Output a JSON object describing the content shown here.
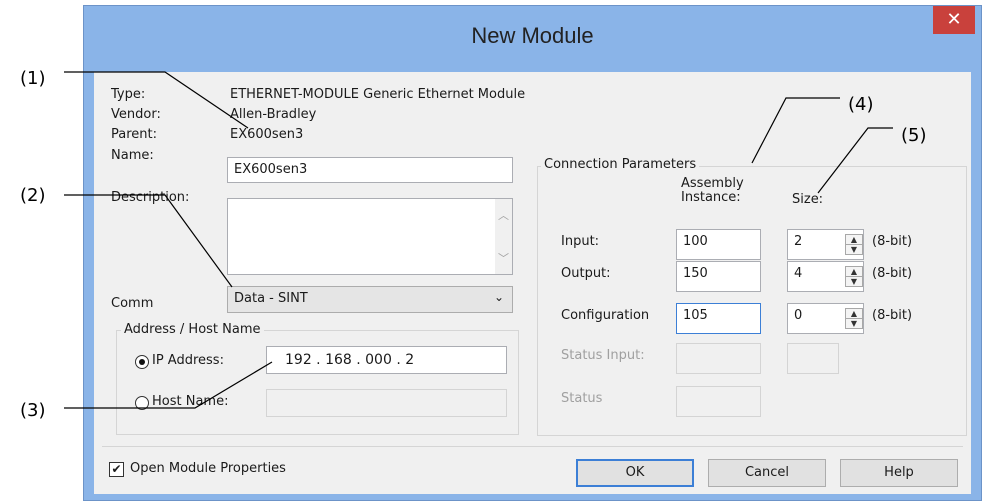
{
  "window": {
    "title": "New Module",
    "close_glyph": "✕"
  },
  "callouts": [
    "(1)",
    "(2)",
    "(3)",
    "(4)",
    "(5)"
  ],
  "info": {
    "type_label": "Type:",
    "type_value": "ETHERNET-MODULE Generic Ethernet Module",
    "vendor_label": "Vendor:",
    "vendor_value": "Allen-Bradley",
    "parent_label": "Parent:",
    "parent_value": "EX600sen3"
  },
  "name": {
    "label": "Name:",
    "value": "EX600sen3"
  },
  "description": {
    "label": "Description:",
    "value": ""
  },
  "comm": {
    "label": "Comm",
    "selected": "Data - SINT"
  },
  "address_group": {
    "title": "Address / Host Name",
    "ip_label": "IP Address:",
    "ip_value": "192 . 168 . 000 . 2",
    "ip_selected": true,
    "host_label": "Host Name:",
    "host_value": ""
  },
  "connection": {
    "title": "Connection Parameters",
    "col_assembly": "Assembly Instance:",
    "col_size": "Size:",
    "unit": "(8-bit)",
    "rows": [
      {
        "label": "Input:",
        "instance": "100",
        "size": "2",
        "enabled": true
      },
      {
        "label": "Output:",
        "instance": "150",
        "size": "4",
        "enabled": true
      },
      {
        "label": "Configuration",
        "instance": "105",
        "size": "0",
        "enabled": true
      },
      {
        "label": "Status Input:",
        "instance": "",
        "size": "",
        "enabled": false
      },
      {
        "label": "Status",
        "instance": "",
        "size": "",
        "enabled": false
      }
    ]
  },
  "footer": {
    "open_props_label": "Open Module Properties",
    "open_props_checked": true,
    "ok": "OK",
    "cancel": "Cancel",
    "help": "Help"
  },
  "colors": {
    "frame": "#8ab4e8",
    "close_button": "#c9413c",
    "client": "#f0f0f0",
    "focus": "#3c7fd6"
  }
}
